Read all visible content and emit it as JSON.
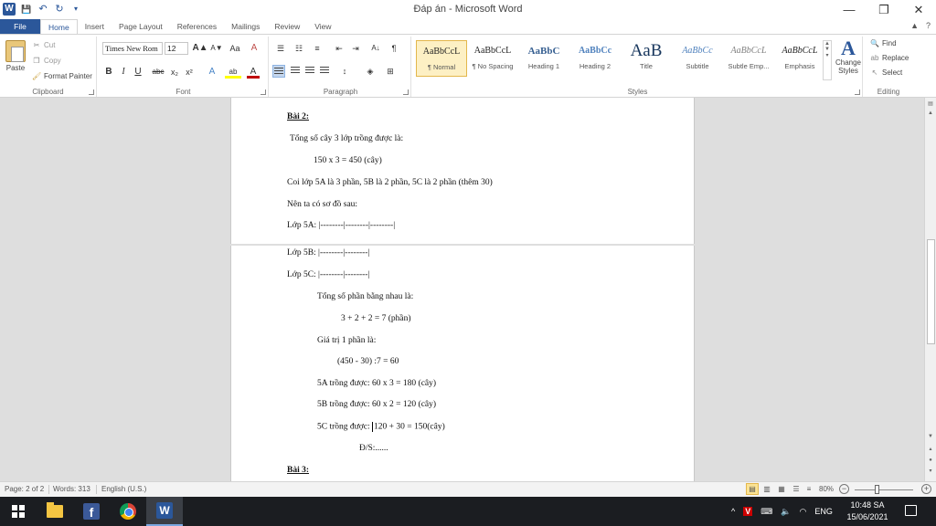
{
  "window": {
    "title": "Đáp án - Microsoft Word",
    "minimize": "—",
    "restore": "❐",
    "close": "✕"
  },
  "qat": {
    "word_icon": "W",
    "save": "💾",
    "undo": "↶",
    "redo": "↻",
    "customize": "▾"
  },
  "tabs": [
    "File",
    "Home",
    "Insert",
    "Page Layout",
    "References",
    "Mailings",
    "Review",
    "View"
  ],
  "tabs_right": {
    "collapse": "▲",
    "help": "?"
  },
  "clipboard": {
    "paste": "Paste",
    "cut": "Cut",
    "copy": "Copy",
    "format_painter": "Format Painter",
    "label": "Clipboard"
  },
  "font": {
    "name": "Times New Rom",
    "size": "12",
    "label": "Font",
    "bold": "B",
    "italic": "I",
    "underline": "U",
    "strike": "abc",
    "subscript": "x₂",
    "superscript": "x²",
    "grow": "A▲",
    "shrink": "A▼",
    "case": "Aa",
    "clear": "A",
    "effects": "A",
    "highlight": "ab",
    "color": "A"
  },
  "paragraph": {
    "label": "Paragraph",
    "show_marks": "¶",
    "sort": "A↓"
  },
  "styles": {
    "label": "Styles",
    "items": [
      {
        "sample": "AaBbCcL",
        "name": "¶ Normal"
      },
      {
        "sample": "AaBbCcL",
        "name": "¶ No Spacing"
      },
      {
        "sample": "AaBbC",
        "name": "Heading 1"
      },
      {
        "sample": "AaBbCc",
        "name": "Heading 2"
      },
      {
        "sample": "AaB",
        "name": "Title"
      },
      {
        "sample": "AaBbCc",
        "name": "Subtitle"
      },
      {
        "sample": "AaBbCcL",
        "name": "Subtle Emp..."
      },
      {
        "sample": "AaBbCcL",
        "name": "Emphasis"
      }
    ],
    "change_styles": "Change Styles",
    "change_styles_glyph": "A"
  },
  "editing": {
    "find": "Find",
    "replace": "Replace",
    "select": "Select",
    "label": "Editing"
  },
  "document": {
    "page1": [
      "Bài 2:",
      "Tổng số cây 3 lớp trồng được là:",
      "150 x 3 = 450 (cây)",
      "Coi lớp 5A là 3 phần, 5B là 2 phần, 5C là 2 phần (thêm 30)",
      "Nên ta có sơ đồ sau:",
      "Lớp 5A: |--------|--------|--------|"
    ],
    "page2": [
      "Lớp 5B: |--------|--------|",
      "Lớp 5C: |--------|--------|",
      "Tổng số phần bằng nhau là:",
      "3 + 2 + 2 = 7 (phần)",
      "Giá trị 1 phần là:",
      "(450 - 30) :7 = 60",
      "5A trồng được: 60 x 3 = 180 (cây)",
      "5B trồng được:  60 x 2 = 120 (cây)",
      "5C trồng được: ",
      "120 + 30 = 150(cây)",
      "Đ/S:......",
      "Bài 3:"
    ]
  },
  "statusbar": {
    "page": "Page: 2 of 2",
    "words": "Words: 313",
    "language": "English (U.S.)",
    "zoom": "80%",
    "zoom_percent": 80
  },
  "taskbar": {
    "tray_lang": "ENG",
    "time": "10:48 SA",
    "date": "15/06/2021",
    "chevron": "^"
  },
  "colors": {
    "accent": "#2b579a",
    "taskbar": "#1b1d21",
    "doc_background": "#dedede"
  }
}
